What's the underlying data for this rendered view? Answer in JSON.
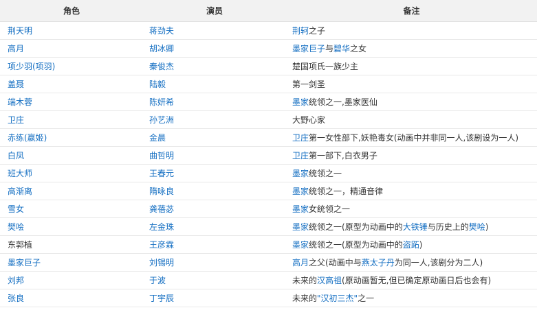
{
  "colors": {
    "link": "#136ec2",
    "text": "#333333",
    "header_bg": "#f2f2f2"
  },
  "table": {
    "headers": [
      "角色",
      "演员",
      "备注"
    ],
    "rows": [
      {
        "role": {
          "text": "荆天明",
          "link": true
        },
        "actor": {
          "text": "蒋劲夫",
          "link": true
        },
        "note": [
          {
            "text": "荆轲",
            "link": true
          },
          {
            "text": "之子",
            "link": false
          }
        ]
      },
      {
        "role": {
          "text": "高月",
          "link": true
        },
        "actor": {
          "text": "胡冰卿",
          "link": true
        },
        "note": [
          {
            "text": "墨家巨子",
            "link": true
          },
          {
            "text": "与",
            "link": false
          },
          {
            "text": "碧华",
            "link": true
          },
          {
            "text": "之女",
            "link": false
          }
        ]
      },
      {
        "role": {
          "text": "项少羽(项羽)",
          "link": true
        },
        "actor": {
          "text": "秦俊杰",
          "link": true
        },
        "note": [
          {
            "text": "楚国项氏一族少主",
            "link": false
          }
        ]
      },
      {
        "role": {
          "text": "盖聂",
          "link": true
        },
        "actor": {
          "text": "陆毅",
          "link": true
        },
        "note": [
          {
            "text": "第一剑圣",
            "link": false
          }
        ]
      },
      {
        "role": {
          "text": "端木蓉",
          "link": true
        },
        "actor": {
          "text": "陈妍希",
          "link": true
        },
        "note": [
          {
            "text": "墨家",
            "link": true
          },
          {
            "text": "统领之一,墨家医仙",
            "link": false
          }
        ]
      },
      {
        "role": {
          "text": "卫庄",
          "link": true
        },
        "actor": {
          "text": "孙艺洲",
          "link": true
        },
        "note": [
          {
            "text": "大野心家",
            "link": false
          }
        ]
      },
      {
        "role": {
          "text": "赤练(嬴姬)",
          "link": true
        },
        "actor": {
          "text": "金晨",
          "link": true
        },
        "note": [
          {
            "text": "卫庄",
            "link": true
          },
          {
            "text": "第一女性部下,妖艳毒女(动画中并非同一人,该剧设为一人)",
            "link": false
          }
        ]
      },
      {
        "role": {
          "text": "白凤",
          "link": true
        },
        "actor": {
          "text": "曲哲明",
          "link": true
        },
        "note": [
          {
            "text": "卫庄",
            "link": true
          },
          {
            "text": "第一部下,白衣男子",
            "link": false
          }
        ]
      },
      {
        "role": {
          "text": "班大师",
          "link": true
        },
        "actor": {
          "text": "王春元",
          "link": true
        },
        "note": [
          {
            "text": "墨家",
            "link": true
          },
          {
            "text": "统领之一",
            "link": false
          }
        ]
      },
      {
        "role": {
          "text": "高渐离",
          "link": true
        },
        "actor": {
          "text": "隋咏良",
          "link": true
        },
        "note": [
          {
            "text": "墨家",
            "link": true
          },
          {
            "text": "统领之一，精通音律",
            "link": false
          }
        ]
      },
      {
        "role": {
          "text": "雪女",
          "link": true
        },
        "actor": {
          "text": "龚蓓苾",
          "link": true
        },
        "note": [
          {
            "text": "墨家",
            "link": true
          },
          {
            "text": "女统领之一",
            "link": false
          }
        ]
      },
      {
        "role": {
          "text": "樊哙",
          "link": true
        },
        "actor": {
          "text": "左金珠",
          "link": true
        },
        "note": [
          {
            "text": "墨家",
            "link": true
          },
          {
            "text": "统领之一(原型为动画中的",
            "link": false
          },
          {
            "text": "大铁锤",
            "link": true
          },
          {
            "text": "与历史上的",
            "link": false
          },
          {
            "text": "樊哙",
            "link": true
          },
          {
            "text": ")",
            "link": false
          }
        ]
      },
      {
        "role": {
          "text": "东郭植",
          "link": false
        },
        "actor": {
          "text": "王彦霖",
          "link": true
        },
        "note": [
          {
            "text": "墨家",
            "link": true
          },
          {
            "text": "统领之一(原型为动画中的",
            "link": false
          },
          {
            "text": "盗跖",
            "link": true
          },
          {
            "text": ")",
            "link": false
          }
        ]
      },
      {
        "role": {
          "text": "墨家巨子",
          "link": true
        },
        "actor": {
          "text": "刘锡明",
          "link": true
        },
        "note": [
          {
            "text": "高月",
            "link": true
          },
          {
            "text": "之父(动画中与",
            "link": false
          },
          {
            "text": "燕太子丹",
            "link": true
          },
          {
            "text": "为同一人,该剧分为二人)",
            "link": false
          }
        ]
      },
      {
        "role": {
          "text": "刘邦",
          "link": true
        },
        "actor": {
          "text": "于波",
          "link": true
        },
        "note": [
          {
            "text": "未来的",
            "link": false
          },
          {
            "text": "汉高祖",
            "link": true
          },
          {
            "text": "(原动画暂无,但已确定原动画日后也会有)",
            "link": false
          }
        ]
      },
      {
        "role": {
          "text": "张良",
          "link": true
        },
        "actor": {
          "text": "丁宇辰",
          "link": true
        },
        "note": [
          {
            "text": "未来的",
            "link": false
          },
          {
            "text": "\"汉初三杰\"",
            "link": true
          },
          {
            "text": "之一",
            "link": false
          }
        ]
      }
    ]
  }
}
